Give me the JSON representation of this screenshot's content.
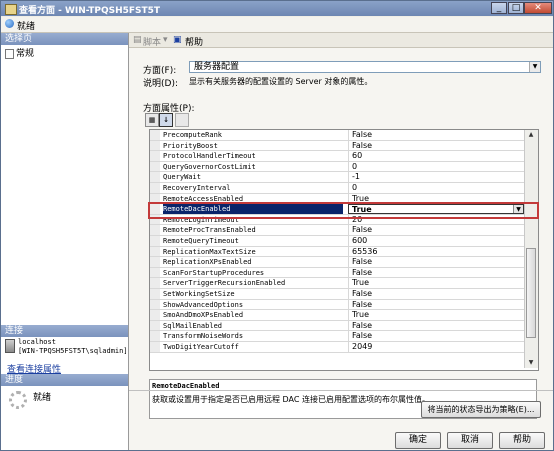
{
  "window": {
    "title": "查看方面 - WIN-TPQSH5FST5T"
  },
  "toolbar": {
    "ready_label": "就绪"
  },
  "left_pane": {
    "select_page_header": "选择页",
    "pages": [
      {
        "label": "常规"
      }
    ],
    "connection_header": "连接",
    "server": "localhost",
    "connection_user": "[WIN-TPQSH5FST5T\\sqladmin]",
    "view_connection_link": "查看连接属性",
    "progress_header": "进度",
    "progress_status": "就绪"
  },
  "right_toolbar": {
    "script_label": "脚本",
    "help_label": "帮助"
  },
  "facet": {
    "label": "方面(F):",
    "value": "服务器配置",
    "description_label": "说明(D):",
    "description": "显示有关服务器的配置设置的 Server 对象的属性。",
    "properties_label": "方面属性(P):"
  },
  "properties": [
    {
      "name": "PrecomputeRank",
      "value": "False"
    },
    {
      "name": "PriorityBoost",
      "value": "False"
    },
    {
      "name": "ProtocolHandlerTimeout",
      "value": "60"
    },
    {
      "name": "QueryGovernorCostLimit",
      "value": "0"
    },
    {
      "name": "QueryWait",
      "value": "-1"
    },
    {
      "name": "RecoveryInterval",
      "value": "0"
    },
    {
      "name": "RemoteAccessEnabled",
      "value": "True"
    },
    {
      "name": "RemoteDacEnabled",
      "value": "True"
    },
    {
      "name": "RemoteLoginTimeout",
      "value": "20"
    },
    {
      "name": "RemoteProcTransEnabled",
      "value": "False"
    },
    {
      "name": "RemoteQueryTimeout",
      "value": "600"
    },
    {
      "name": "ReplicationMaxTextSize",
      "value": "65536"
    },
    {
      "name": "ReplicationXPsEnabled",
      "value": "False"
    },
    {
      "name": "ScanForStartupProcedures",
      "value": "False"
    },
    {
      "name": "ServerTriggerRecursionEnabled",
      "value": "True"
    },
    {
      "name": "SetWorkingSetSize",
      "value": "False"
    },
    {
      "name": "ShowAdvancedOptions",
      "value": "False"
    },
    {
      "name": "SmoAndDmoXPsEnabled",
      "value": "True"
    },
    {
      "name": "SqlMailEnabled",
      "value": "False"
    },
    {
      "name": "TransformNoiseWords",
      "value": "False"
    },
    {
      "name": "TwoDigitYearCutoff",
      "value": "2049"
    }
  ],
  "selected_property_index": 7,
  "property_description": {
    "title": "RemoteDacEnabled",
    "text": "获取或设置用于指定是否已启用远程 DAC 连接已启用配置选项的布尔属性值。"
  },
  "buttons": {
    "export_label": "将当前的状态导出为策略(E)...",
    "ok_label": "确定",
    "cancel_label": "取消",
    "help_label": "帮助"
  },
  "colors": {
    "selection": "#0a246a",
    "highlight_box": "#c33a3a",
    "header_gradient": "#7b93bd"
  }
}
